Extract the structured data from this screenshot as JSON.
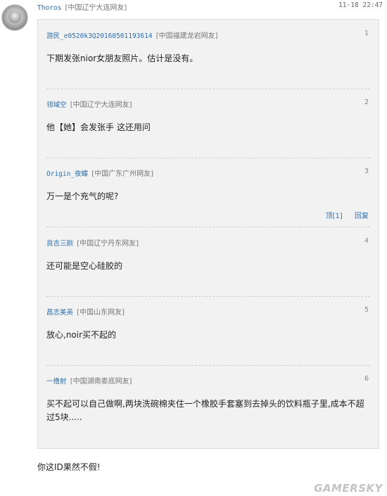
{
  "post": {
    "username": "Thoros",
    "location": "[中国辽宁大连网友]",
    "timestamp": "11-18 22:47",
    "reply_text": "你这ID果然不假!"
  },
  "quotes": [
    {
      "username": "游民_e0520k3Q20160501193614",
      "location": "[中国福建龙岩网友]",
      "floor": "1",
      "text": "下期发张nior女朋友照片。估计是没有。"
    },
    {
      "username": "领域空",
      "location": "[中国辽宁大连网友]",
      "floor": "2",
      "text": "他【她】会发张手 这还用问"
    },
    {
      "username": "Origin_夜蝶",
      "location": "[中国广东广州网友]",
      "floor": "3",
      "text": "万一是个充气的呢?",
      "actions": {
        "top": "顶[1]",
        "reply": "回复"
      }
    },
    {
      "username": "良吉三颜",
      "location": "[中国辽宁丹东网友]",
      "floor": "4",
      "text": "还可能是空心硅胶的"
    },
    {
      "username": "昌志美英",
      "location": "[中国山东网友]",
      "floor": "5",
      "text": "放心,noir买不起的"
    },
    {
      "username": "一撸射",
      "location": "[中国湖南娄底网友]",
      "floor": "6",
      "text": "买不起可以自己做啊,两块洗碗棉夹住一个橡胶手套塞到去掉头的饮料瓶子里,成本不超过5块....."
    }
  ],
  "watermark": "GAMERSKY"
}
